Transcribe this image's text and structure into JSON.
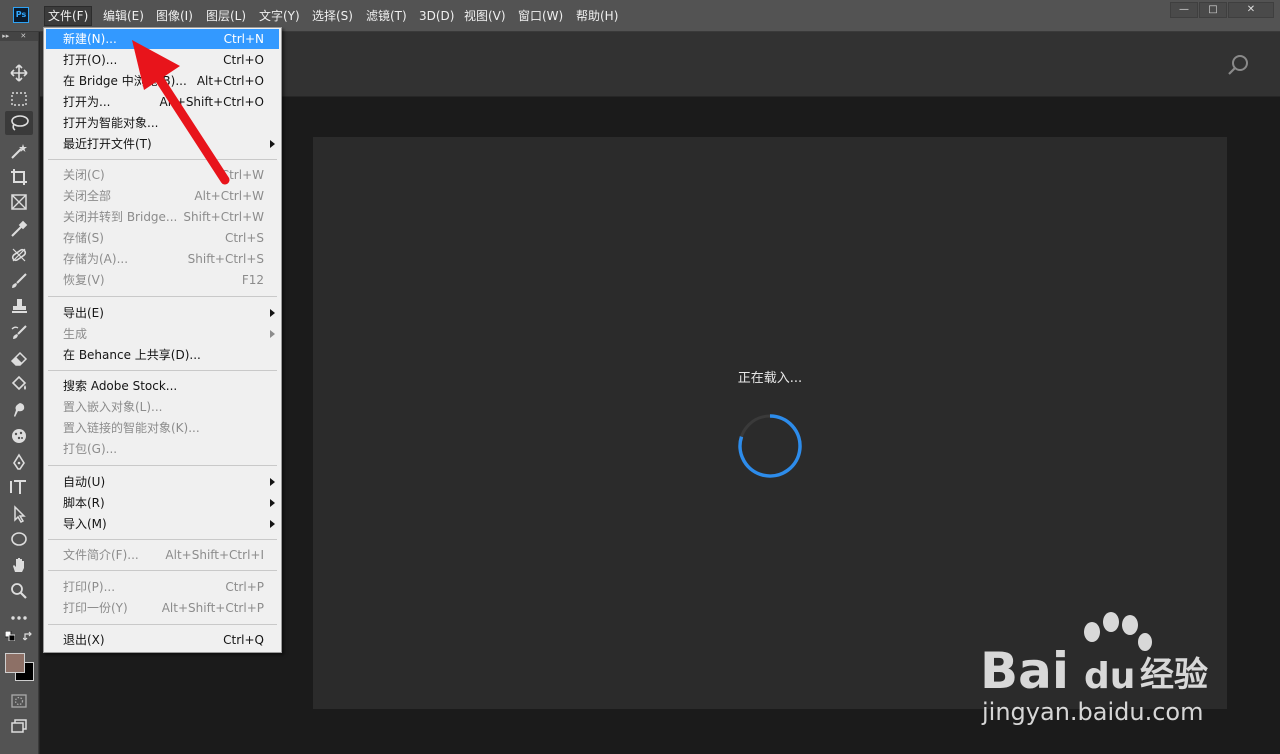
{
  "app": {
    "logo": "Ps"
  },
  "menubar": {
    "items": [
      {
        "label": "文件(F)"
      },
      {
        "label": "编辑(E)"
      },
      {
        "label": "图像(I)"
      },
      {
        "label": "图层(L)"
      },
      {
        "label": "文字(Y)"
      },
      {
        "label": "选择(S)"
      },
      {
        "label": "滤镜(T)"
      },
      {
        "label": "3D(D)"
      },
      {
        "label": "视图(V)"
      },
      {
        "label": "窗口(W)"
      },
      {
        "label": "帮助(H)"
      }
    ],
    "window_controls": {
      "minimize": "—",
      "maximize": "□",
      "close": "✕"
    }
  },
  "file_menu": {
    "items": [
      {
        "label": "新建(N)...",
        "shortcut": "Ctrl+N"
      },
      {
        "label": "打开(O)...",
        "shortcut": "Ctrl+O"
      },
      {
        "label": "在 Bridge 中浏览(B)...",
        "shortcut": "Alt+Ctrl+O"
      },
      {
        "label": "打开为...",
        "shortcut": "Alt+Shift+Ctrl+O"
      },
      {
        "label": "打开为智能对象...",
        "shortcut": ""
      },
      {
        "label": "最近打开文件(T)",
        "shortcut": ""
      },
      {
        "label": "关闭(C)",
        "shortcut": "Ctrl+W"
      },
      {
        "label": "关闭全部",
        "shortcut": "Alt+Ctrl+W"
      },
      {
        "label": "关闭并转到 Bridge...",
        "shortcut": "Shift+Ctrl+W"
      },
      {
        "label": "存储(S)",
        "shortcut": "Ctrl+S"
      },
      {
        "label": "存储为(A)...",
        "shortcut": "Shift+Ctrl+S"
      },
      {
        "label": "恢复(V)",
        "shortcut": "F12"
      },
      {
        "label": "导出(E)",
        "shortcut": ""
      },
      {
        "label": "生成",
        "shortcut": ""
      },
      {
        "label": "在 Behance 上共享(D)...",
        "shortcut": ""
      },
      {
        "label": "搜索 Adobe Stock...",
        "shortcut": ""
      },
      {
        "label": "置入嵌入对象(L)...",
        "shortcut": ""
      },
      {
        "label": "置入链接的智能对象(K)...",
        "shortcut": ""
      },
      {
        "label": "打包(G)...",
        "shortcut": ""
      },
      {
        "label": "自动(U)",
        "shortcut": ""
      },
      {
        "label": "脚本(R)",
        "shortcut": ""
      },
      {
        "label": "导入(M)",
        "shortcut": ""
      },
      {
        "label": "文件简介(F)...",
        "shortcut": "Alt+Shift+Ctrl+I"
      },
      {
        "label": "打印(P)...",
        "shortcut": "Ctrl+P"
      },
      {
        "label": "打印一份(Y)",
        "shortcut": "Alt+Shift+Ctrl+P"
      },
      {
        "label": "退出(X)",
        "shortcut": "Ctrl+Q"
      }
    ]
  },
  "workspace": {
    "loading_text": "正在载入..."
  },
  "colors": {
    "foreground": "#8d7066",
    "background": "#000000",
    "highlight": "#3399ff",
    "annotation_arrow": "#e8141b"
  },
  "watermark": {
    "brand": "Bai",
    "brand2": "du",
    "product": "经验",
    "url": "jingyan.baidu.com"
  }
}
